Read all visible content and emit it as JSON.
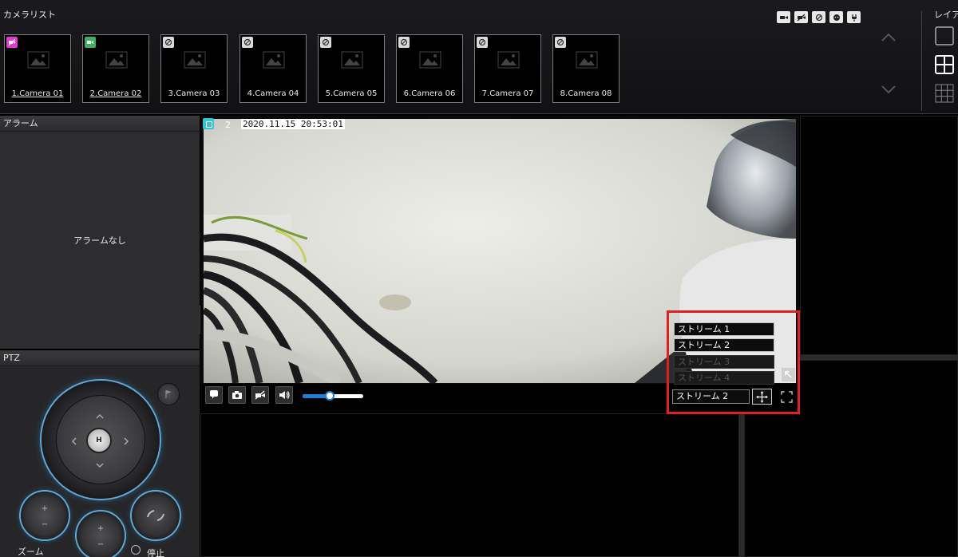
{
  "camera_list": {
    "title": "カメラリスト",
    "cameras": [
      {
        "label": "1.Camera 01",
        "status": "magenta",
        "icon": "camera-off-icon"
      },
      {
        "label": "2.Camera 02",
        "status": "green",
        "icon": "camera-icon"
      },
      {
        "label": "3.Camera 03",
        "status": "gray",
        "icon": "disabled-icon"
      },
      {
        "label": "4.Camera 04",
        "status": "gray",
        "icon": "disabled-icon"
      },
      {
        "label": "5.Camera 05",
        "status": "gray",
        "icon": "disabled-icon"
      },
      {
        "label": "6.Camera 06",
        "status": "gray",
        "icon": "disabled-icon"
      },
      {
        "label": "7.Camera 07",
        "status": "gray",
        "icon": "disabled-icon"
      },
      {
        "label": "8.Camera 08",
        "status": "gray",
        "icon": "disabled-icon"
      }
    ],
    "status_icons": [
      "camera-icon",
      "camera-off-icon",
      "disabled-icon",
      "alert-icon",
      "plug-icon"
    ]
  },
  "layout": {
    "title": "レイア",
    "options": [
      "layout-1x1-icon",
      "layout-2x2-icon",
      "layout-3x3-icon"
    ]
  },
  "alarm": {
    "title": "アラーム",
    "empty_text": "アラームなし"
  },
  "ptz": {
    "title": "PTZ",
    "home_label": "H",
    "zoom_label": "ズーム",
    "stop_label": "停止"
  },
  "video": {
    "channel": "2",
    "timestamp": "2020.11.15 20:53:01",
    "volume_fraction": 0.45
  },
  "stream_menu": {
    "items": [
      {
        "label": "ストリーム 1",
        "enabled": true
      },
      {
        "label": "ストリーム 2",
        "enabled": true
      },
      {
        "label": "ストリーム 3",
        "enabled": false
      },
      {
        "label": "ストリーム 4",
        "enabled": false
      }
    ],
    "selected": "ストリーム 2"
  },
  "colors": {
    "accent": "#1d80d8",
    "highlight": "#e02020",
    "channel_badge": "#34c3d3"
  }
}
